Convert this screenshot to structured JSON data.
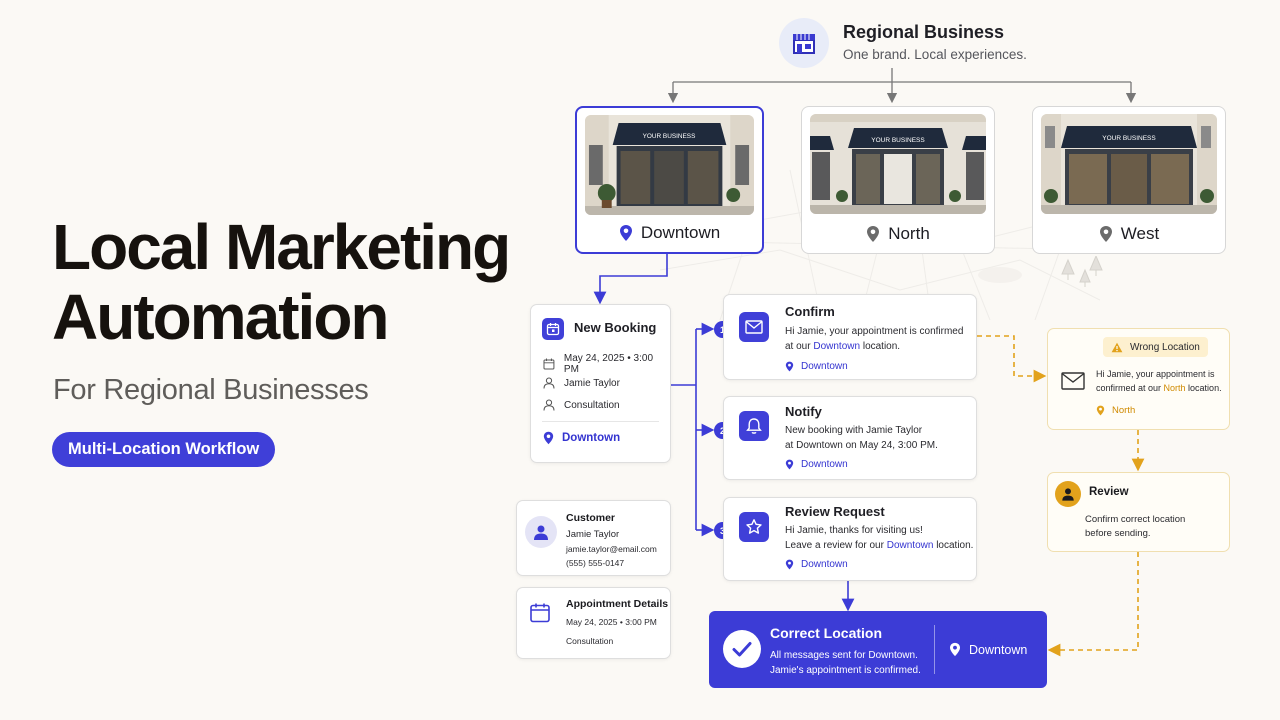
{
  "hero": {
    "title_line1": "Local Marketing",
    "title_line2": "Automation",
    "subtitle": "For Regional Businesses",
    "badge": "Multi-Location Workflow"
  },
  "header": {
    "title": "Regional Business",
    "subtitle": "One brand. Local experiences.",
    "icon": "storefront-icon"
  },
  "locations": [
    {
      "name": "Downtown",
      "sign": "YOUR BUSINESS",
      "active": true
    },
    {
      "name": "North",
      "sign": "YOUR BUSINESS",
      "active": false
    },
    {
      "name": "West",
      "sign": "YOUR BUSINESS",
      "active": false
    }
  ],
  "booking": {
    "title": "New Booking",
    "date": "May 24, 2025  •  3:00 PM",
    "customer": "Jamie Taylor",
    "service": "Consultation",
    "location": "Downtown"
  },
  "customer_card": {
    "title": "Customer",
    "name": "Jamie Taylor",
    "email": "jamie.taylor@email.com",
    "phone": "(555) 555-0147"
  },
  "appointment_card": {
    "title": "Appointment Details",
    "date": "May 24, 2025  •  3:00 PM",
    "service": "Consultation"
  },
  "steps": [
    {
      "number": "1",
      "title": "Confirm",
      "text_before": "Hi Jamie, your appointment is confirmed at our ",
      "highlight": "Downtown",
      "text_after": " location.",
      "location": "Downtown",
      "icon": "envelope-icon"
    },
    {
      "number": "2",
      "title": "Notify",
      "line1": "New booking with Jamie Taylor",
      "line2": "at Downtown on May 24, 3:00 PM.",
      "location": "Downtown",
      "icon": "bell-icon"
    },
    {
      "number": "3",
      "title": "Review Request",
      "line1": "Hi Jamie, thanks for visiting us!",
      "line2_before": "Leave a review for our ",
      "highlight": "Downtown",
      "line2_after": " location.",
      "location": "Downtown",
      "icon": "star-icon"
    }
  ],
  "wrong_location": {
    "label": "Wrong Location",
    "line1": "Hi Jamie, your appointment is",
    "line2_before": "confirmed at our ",
    "highlight": "North",
    "line2_after": " location.",
    "location": "North"
  },
  "review": {
    "title": "Review",
    "line1": "Confirm correct location",
    "line2": "before sending."
  },
  "correct": {
    "title": "Correct Location",
    "line1": "All messages sent for Downtown.",
    "line2": "Jamie's appointment is confirmed.",
    "location": "Downtown"
  },
  "colors": {
    "brand_blue": "#3c3cd6",
    "amber": "#e2a21c",
    "background": "#fbf9f5"
  }
}
